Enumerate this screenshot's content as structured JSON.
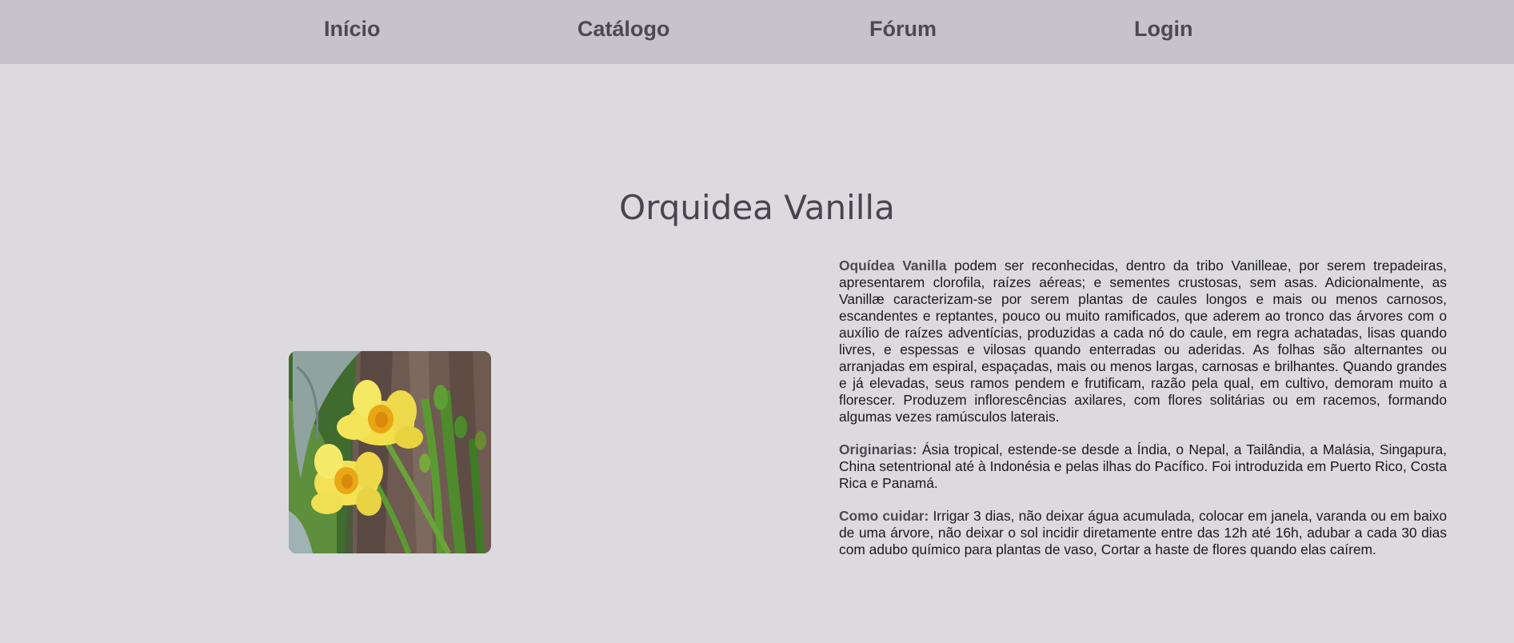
{
  "nav": {
    "items": [
      {
        "label": "Início"
      },
      {
        "label": "Catálogo"
      },
      {
        "label": "Fórum"
      },
      {
        "label": "Login"
      }
    ]
  },
  "main": {
    "title": "Orquidea Vanilla",
    "image_alt": "Orquídea Vanilla com flores amarelas",
    "description": {
      "p1_label": "Oquídea Vanilla",
      "p1_text": " podem ser reconhecidas, dentro da tribo Vanilleae, por serem trepadeiras, apresentarem clorofila, raízes aéreas; e sementes crustosas, sem asas. Adicionalmente, as Vanillæ caracterizam-se por serem plantas de caules longos e mais ou menos carnosos, escandentes e reptantes, pouco ou muito ramificados, que aderem ao tronco das árvores com o auxílio de raízes adventícias, produzidas a cada nó do caule, em regra achatadas, lisas quando livres, e espessas e vilosas quando enterradas ou aderidas. As folhas são alternantes ou arranjadas em espiral, espaçadas, mais ou menos largas, carnosas e brilhantes. Quando grandes e já elevadas, seus ramos pendem e frutificam, razão pela qual, em cultivo, demoram muito a florescer. Produzem inflorescências axilares, com flores solitárias ou em racemos, formando algumas vezes ramúsculos laterais.",
      "p2_label": "Originarias:",
      "p2_text": " Ásia tropical, estende-se desde a Índia, o Nepal, a Tailândia, a Malásia, Singapura, China setentrional até à Indonésia e pelas ilhas do Pacífico. Foi introduzida em Puerto Rico, Costa Rica e Panamá.",
      "p3_label": "Como cuidar:",
      "p3_text": " Irrigar 3 dias, não deixar água acumulada, colocar em janela, varanda ou em baixo de uma árvore, não deixar o sol incidir diretamente entre das 12h até 16h, adubar a cada 30 dias com adubo químico para plantas de vaso, Cortar a haste de flores quando elas caírem."
    }
  },
  "colors": {
    "background": "#dcdadf",
    "navbar": "#c8c3ca",
    "nav_text": "#4f4853",
    "title": "#4b4450",
    "label": "#4f4853"
  }
}
